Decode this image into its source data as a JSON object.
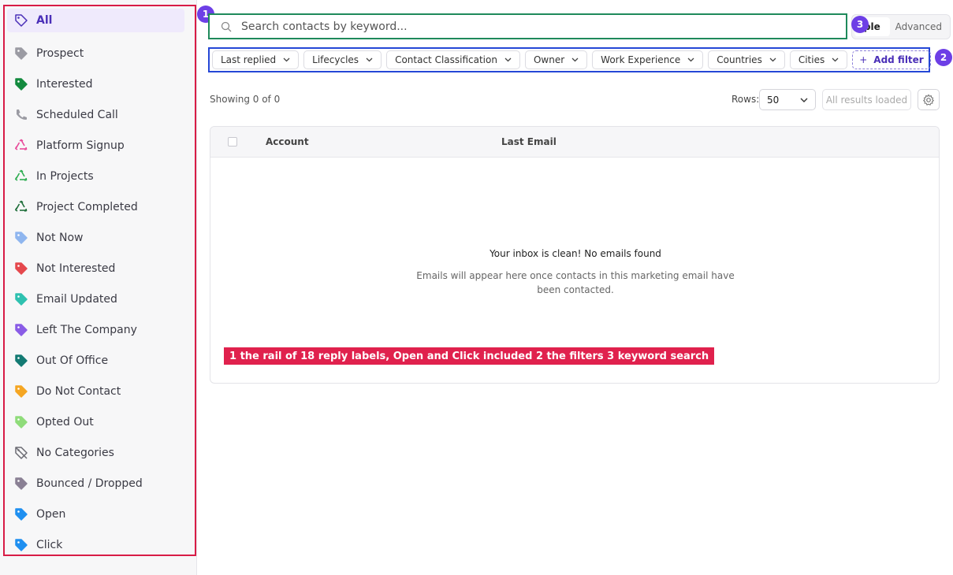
{
  "sidebar": {
    "items": [
      {
        "label": "All",
        "icon": "tag-outline-icon",
        "color": "#4a2fb8",
        "active": true
      },
      {
        "label": "Prospect",
        "icon": "tag-icon",
        "color": "#9b9ba3"
      },
      {
        "label": "Interested",
        "icon": "tag-icon",
        "color": "#138a3e"
      },
      {
        "label": "Scheduled Call",
        "icon": "phone-icon",
        "color": "#9b9ba3"
      },
      {
        "label": "Platform Signup",
        "icon": "recycle-icon",
        "color": "#e84a9a"
      },
      {
        "label": "In Projects",
        "icon": "recycle-icon",
        "color": "#2fae52"
      },
      {
        "label": "Project Completed",
        "icon": "recycle-icon",
        "color": "#1f6e3a"
      },
      {
        "label": "Not Now",
        "icon": "tag-icon",
        "color": "#8fb6ef"
      },
      {
        "label": "Not Interested",
        "icon": "tag-icon",
        "color": "#e5484d"
      },
      {
        "label": "Email Updated",
        "icon": "tag-icon",
        "color": "#2fc1b0"
      },
      {
        "label": "Left The Company",
        "icon": "tag-icon",
        "color": "#8a5ce6"
      },
      {
        "label": "Out Of Office",
        "icon": "tag-icon",
        "color": "#137a73"
      },
      {
        "label": "Do Not Contact",
        "icon": "tag-icon",
        "color": "#f5a623"
      },
      {
        "label": "Opted Out",
        "icon": "tag-icon",
        "color": "#8fdc7a"
      },
      {
        "label": "No Categories",
        "icon": "tag-slash-icon",
        "color": "#6b6b73"
      },
      {
        "label": "Bounced / Dropped",
        "icon": "tag-icon",
        "color": "#8a8094"
      },
      {
        "label": "Open",
        "icon": "tag-icon",
        "color": "#1f8ff0"
      },
      {
        "label": "Click",
        "icon": "tag-icon",
        "color": "#1f8ff0"
      }
    ]
  },
  "badges": {
    "one": "1",
    "two": "2",
    "three": "3"
  },
  "search": {
    "placeholder": "Search contacts by keyword..."
  },
  "mode": {
    "simple": "ple",
    "advanced": "Advanced"
  },
  "filters": {
    "items": [
      "Last replied",
      "Lifecycles",
      "Contact Classification",
      "Owner",
      "Work Experience",
      "Countries",
      "Cities"
    ],
    "add_label": "Add filter"
  },
  "toolbar": {
    "showing": "Showing 0 of 0",
    "rows_label": "Rows:",
    "rows_value": "50",
    "all_loaded": "All results loaded"
  },
  "table": {
    "columns": [
      "Account",
      "Last Email"
    ],
    "empty_title": "Your inbox is clean! No emails found",
    "empty_desc": "Emails will appear here once contacts in this marketing email have been contacted."
  },
  "legend": {
    "text": "1 the rail of 18 reply labels, Open and Click included   2 the filters   3 keyword search"
  }
}
